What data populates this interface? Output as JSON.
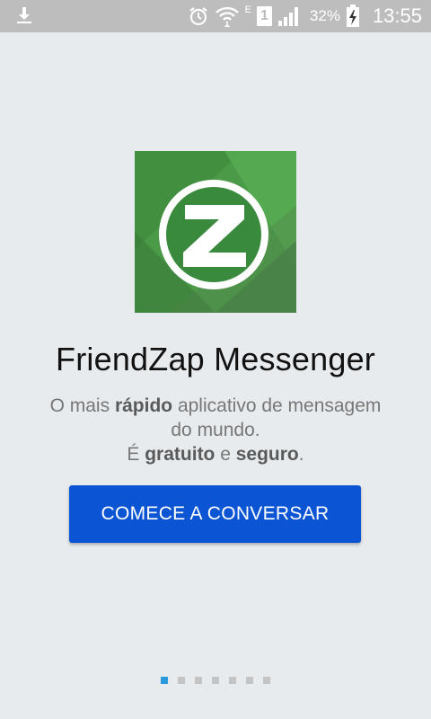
{
  "status_bar": {
    "icons": [
      "download-icon",
      "alarm-icon",
      "wifi-icon",
      "sim-1-icon",
      "signal-icon",
      "battery-charging-icon"
    ],
    "network_type": "E",
    "sim_slot": "1",
    "battery_percent": "32%",
    "time": "13:55"
  },
  "app": {
    "logo_letter": "Z",
    "title": "FriendZap Messenger",
    "tagline": {
      "line1_a": "O mais ",
      "line1_bold": "rápido",
      "line1_b": " aplicativo de mensagem",
      "line2": "do mundo.",
      "line3_a": "É ",
      "line3_bold1": "gratuito",
      "line3_mid": " e ",
      "line3_bold2": "seguro",
      "line3_end": "."
    },
    "cta_label": "COMECE A CONVERSAR"
  },
  "pager": {
    "total": 7,
    "active_index": 0
  },
  "colors": {
    "background": "#e8ebed",
    "status_bar": "#bdbdbd",
    "logo_green": "#4a9a48",
    "cta_blue": "#0b55d4",
    "dot_active": "#2a9ae0",
    "dot_inactive": "#c4c4c4"
  }
}
